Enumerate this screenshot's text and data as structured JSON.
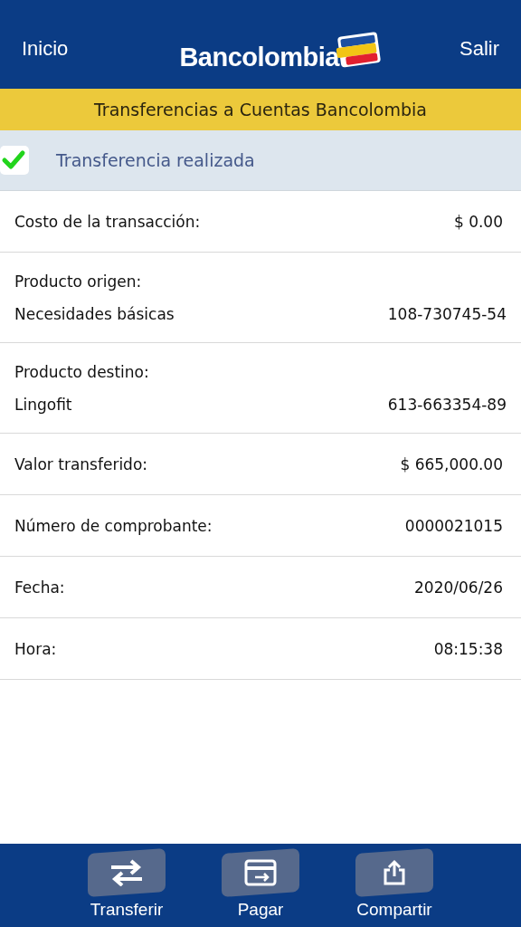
{
  "header": {
    "left_link": "Inicio",
    "logo_text": "Bancolombia",
    "right_link": "Salir"
  },
  "title_bar": "Transferencias a Cuentas Bancolombia",
  "status": {
    "text": "Transferencia realizada",
    "success": true
  },
  "rows": [
    {
      "kind": "single",
      "label": "Costo de la transacción:",
      "value": "$ 0.00"
    },
    {
      "kind": "double",
      "label": "Producto origen:",
      "sublabel": "Necesidades básicas",
      "value": "108-730745-54"
    },
    {
      "kind": "double",
      "label": "Producto destino:",
      "sublabel": "Lingofit",
      "value": "613-663354-89"
    },
    {
      "kind": "single",
      "label": "Valor transferido:",
      "value": "$ 665,000.00"
    },
    {
      "kind": "single",
      "label": "Número de comprobante:",
      "value": "0000021015"
    },
    {
      "kind": "single",
      "label": "Fecha:",
      "value": "2020/06/26"
    },
    {
      "kind": "single",
      "label": "Hora:",
      "value": "08:15:38"
    }
  ],
  "toolbar": [
    {
      "kind": "transfer",
      "label": "Transferir"
    },
    {
      "kind": "pay",
      "label": "Pagar"
    },
    {
      "kind": "share",
      "label": "Compartir"
    }
  ]
}
